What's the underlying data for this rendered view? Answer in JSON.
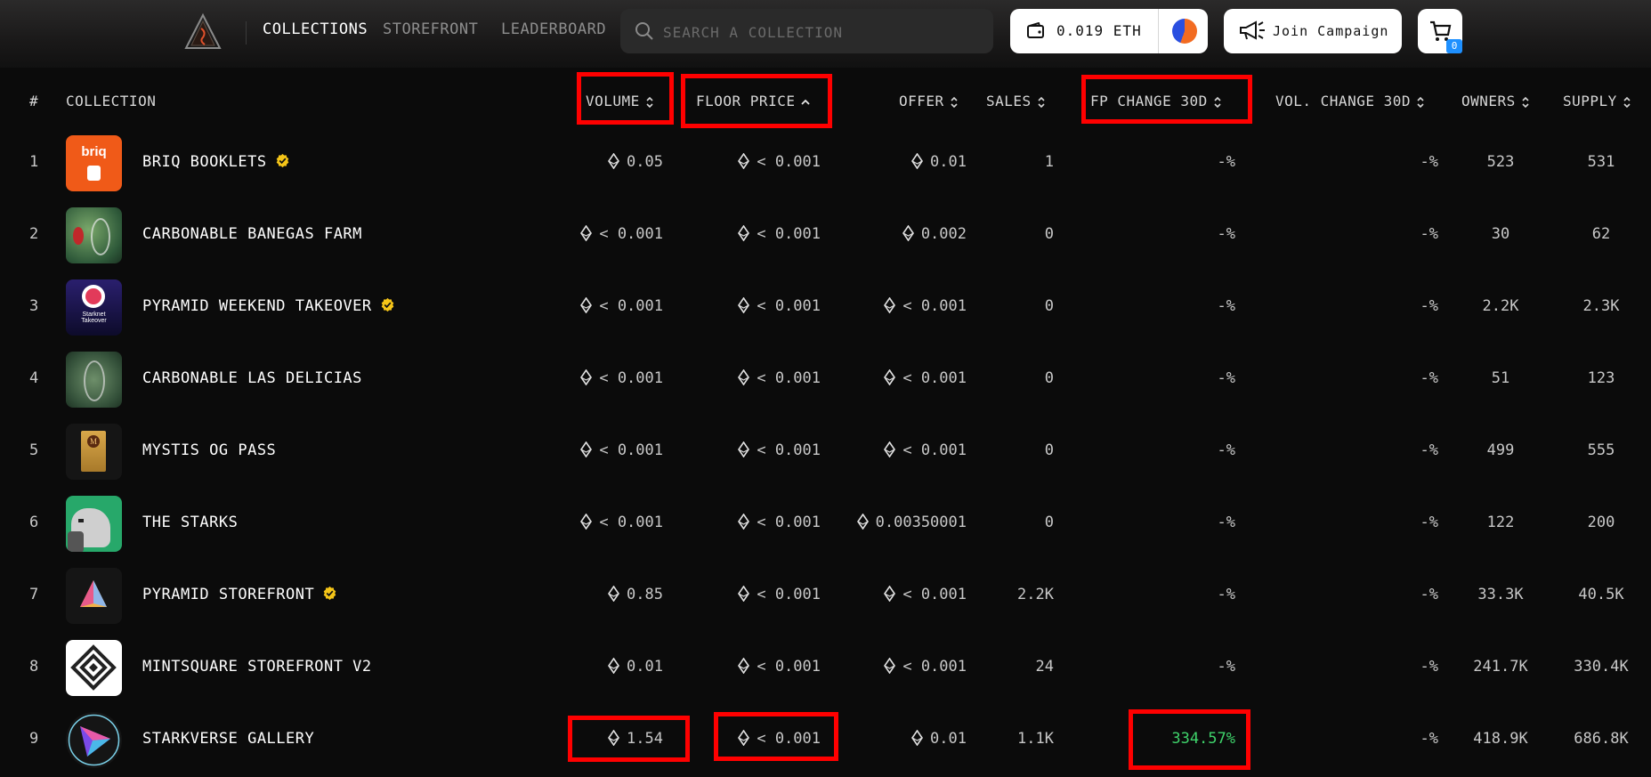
{
  "header": {
    "nav": [
      {
        "label": "Collections",
        "active": true
      },
      {
        "label": "Storefront",
        "active": false
      },
      {
        "label": "Leaderboard",
        "active": false
      }
    ],
    "search_placeholder": "Search a collection",
    "wallet_balance": "0.019 ETH",
    "campaign_label": "Join Campaign",
    "cart_count": "0"
  },
  "table": {
    "columns": [
      "#",
      "Collection",
      "Volume",
      "Floor Price",
      "Offer",
      "Sales",
      "FP Change 30D",
      "Vol. Change 30D",
      "Owners",
      "Supply"
    ],
    "sorted_column": "Floor Price",
    "sort_direction": "ascending",
    "rows": [
      {
        "rank": "1",
        "name": "briq Booklets",
        "verified": true,
        "volume": "0.05",
        "floor": "< 0.001",
        "offer": "0.01",
        "sales": "1",
        "fp_change": "-%",
        "vol_change": "-%",
        "owners": "523",
        "supply": "531"
      },
      {
        "rank": "2",
        "name": "Carbonable Banegas Farm",
        "verified": false,
        "volume": "< 0.001",
        "floor": "< 0.001",
        "offer": "0.002",
        "sales": "0",
        "fp_change": "-%",
        "vol_change": "-%",
        "owners": "30",
        "supply": "62"
      },
      {
        "rank": "3",
        "name": "Pyramid Weekend Takeover",
        "verified": true,
        "volume": "< 0.001",
        "floor": "< 0.001",
        "offer": "< 0.001",
        "sales": "0",
        "fp_change": "-%",
        "vol_change": "-%",
        "owners": "2.2K",
        "supply": "2.3K"
      },
      {
        "rank": "4",
        "name": "Carbonable Las Delicias",
        "verified": false,
        "volume": "< 0.001",
        "floor": "< 0.001",
        "offer": "< 0.001",
        "sales": "0",
        "fp_change": "-%",
        "vol_change": "-%",
        "owners": "51",
        "supply": "123"
      },
      {
        "rank": "5",
        "name": "Mystis OG Pass",
        "verified": false,
        "volume": "< 0.001",
        "floor": "< 0.001",
        "offer": "< 0.001",
        "sales": "0",
        "fp_change": "-%",
        "vol_change": "-%",
        "owners": "499",
        "supply": "555"
      },
      {
        "rank": "6",
        "name": "The Starks",
        "verified": false,
        "volume": "< 0.001",
        "floor": "< 0.001",
        "offer": "0.00350001",
        "sales": "0",
        "fp_change": "-%",
        "vol_change": "-%",
        "owners": "122",
        "supply": "200"
      },
      {
        "rank": "7",
        "name": "Pyramid Storefront",
        "verified": true,
        "volume": "0.85",
        "floor": "< 0.001",
        "offer": "< 0.001",
        "sales": "2.2K",
        "fp_change": "-%",
        "vol_change": "-%",
        "owners": "33.3K",
        "supply": "40.5K"
      },
      {
        "rank": "8",
        "name": "Mintsquare Storefront V2",
        "verified": false,
        "volume": "0.01",
        "floor": "< 0.001",
        "offer": "< 0.001",
        "sales": "24",
        "fp_change": "-%",
        "vol_change": "-%",
        "owners": "241.7K",
        "supply": "330.4K"
      },
      {
        "rank": "9",
        "name": "Starkverse Gallery",
        "verified": false,
        "volume": "1.54",
        "floor": "< 0.001",
        "offer": "0.01",
        "sales": "1.1K",
        "fp_change": "334.57%",
        "vol_change": "-%",
        "owners": "418.9K",
        "supply": "686.8K"
      }
    ]
  },
  "colors": {
    "background": "#0b0b0b",
    "highlight": "#ff0000",
    "positive_change": "#3fd36b",
    "verified_badge": "#f5c518",
    "cart_badge": "#1e90ff"
  },
  "icons": [
    "logo-icon",
    "search-icon",
    "wallet-icon",
    "megaphone-icon",
    "cart-icon",
    "eth-icon",
    "verified-badge-icon",
    "sort-chevron-icon"
  ]
}
